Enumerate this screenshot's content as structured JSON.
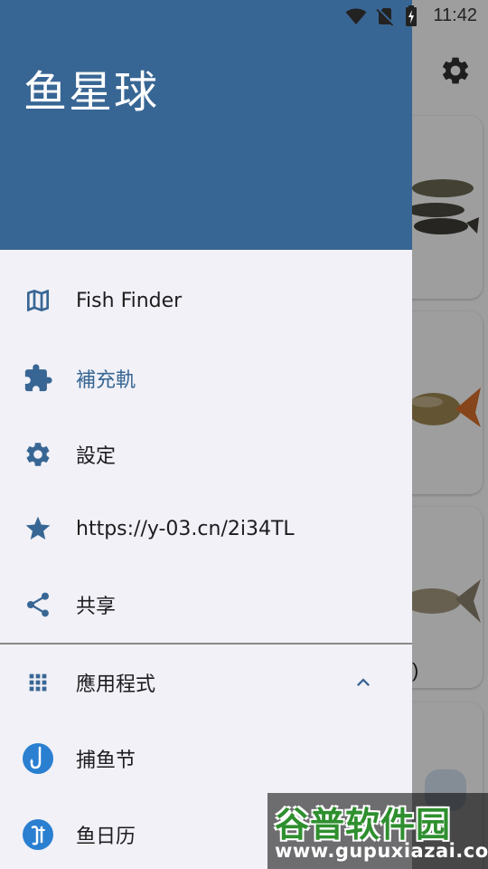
{
  "status_bar": {
    "time": "11:42"
  },
  "drawer": {
    "title": "鱼星球",
    "items": [
      {
        "label": "Fish Finder",
        "icon": "map-icon"
      },
      {
        "label": "補充軌",
        "icon": "puzzle-icon",
        "active": true
      },
      {
        "label": "設定",
        "icon": "gear-icon"
      },
      {
        "label": "https://y-03.cn/2i34TL",
        "icon": "star-icon"
      },
      {
        "label": "共享",
        "icon": "share-icon"
      }
    ],
    "apps_section": {
      "label": "應用程式",
      "icon": "apps-grid-icon",
      "expanded_icon": "chevron-up-icon",
      "items": [
        {
          "label": "捕鱼节",
          "icon": "fishing-hook-icon"
        },
        {
          "label": "鱼日历",
          "icon": "fish-calendar-icon"
        }
      ]
    }
  },
  "background": {
    "partial_text": ")"
  },
  "watermark": {
    "title": "谷普软件园",
    "url": "www.gupuxiazai.com"
  },
  "colors": {
    "accent": "#386694",
    "drawer_bg": "#f1f1f7",
    "text": "#1d1d1f"
  }
}
